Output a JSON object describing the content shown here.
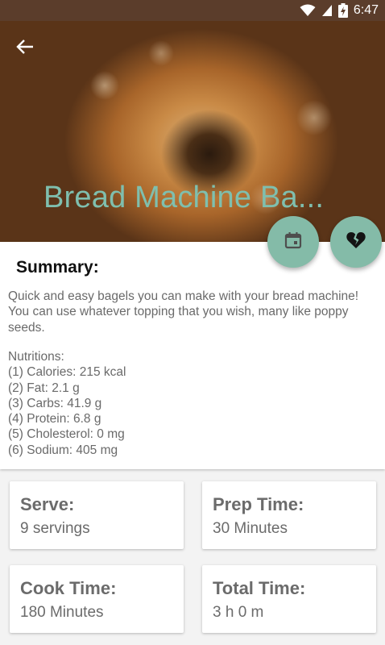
{
  "status_bar": {
    "time": "6:47",
    "icons": [
      "wifi-icon",
      "cell-signal-icon",
      "battery-charging-icon"
    ]
  },
  "header": {
    "back_icon": "arrow-back-icon",
    "title": "Bread Machine Ba...",
    "actions": [
      {
        "name": "calendar-icon",
        "color": "#84bba8"
      },
      {
        "name": "broken-heart-icon",
        "color": "#84bba8"
      }
    ]
  },
  "summary": {
    "heading": "Summary:",
    "description": "Quick and easy bagels you can make with your bread machine! You can use whatever topping that you wish, many like poppy seeds.",
    "nutritions_label": "Nutritions:",
    "nutritions": [
      "(1) Calories: 215 kcal",
      "(2) Fat: 2.1 g",
      "(3) Carbs: 41.9 g",
      "(4) Protein: 6.8 g",
      "(5) Cholesterol: 0 mg",
      "(6) Sodium: 405 mg"
    ]
  },
  "info_cards": {
    "serve": {
      "label": "Serve:",
      "value": "9 servings"
    },
    "prep": {
      "label": "Prep Time:",
      "value": "30 Minutes"
    },
    "cook": {
      "label": "Cook Time:",
      "value": "180 Minutes"
    },
    "total": {
      "label": "Total Time:",
      "value": "3 h 0 m"
    }
  },
  "colors": {
    "status_bar": "#5b3d2b",
    "accent": "#84bba8",
    "title": "#7fbfae",
    "body_text": "#6a6a6a"
  }
}
